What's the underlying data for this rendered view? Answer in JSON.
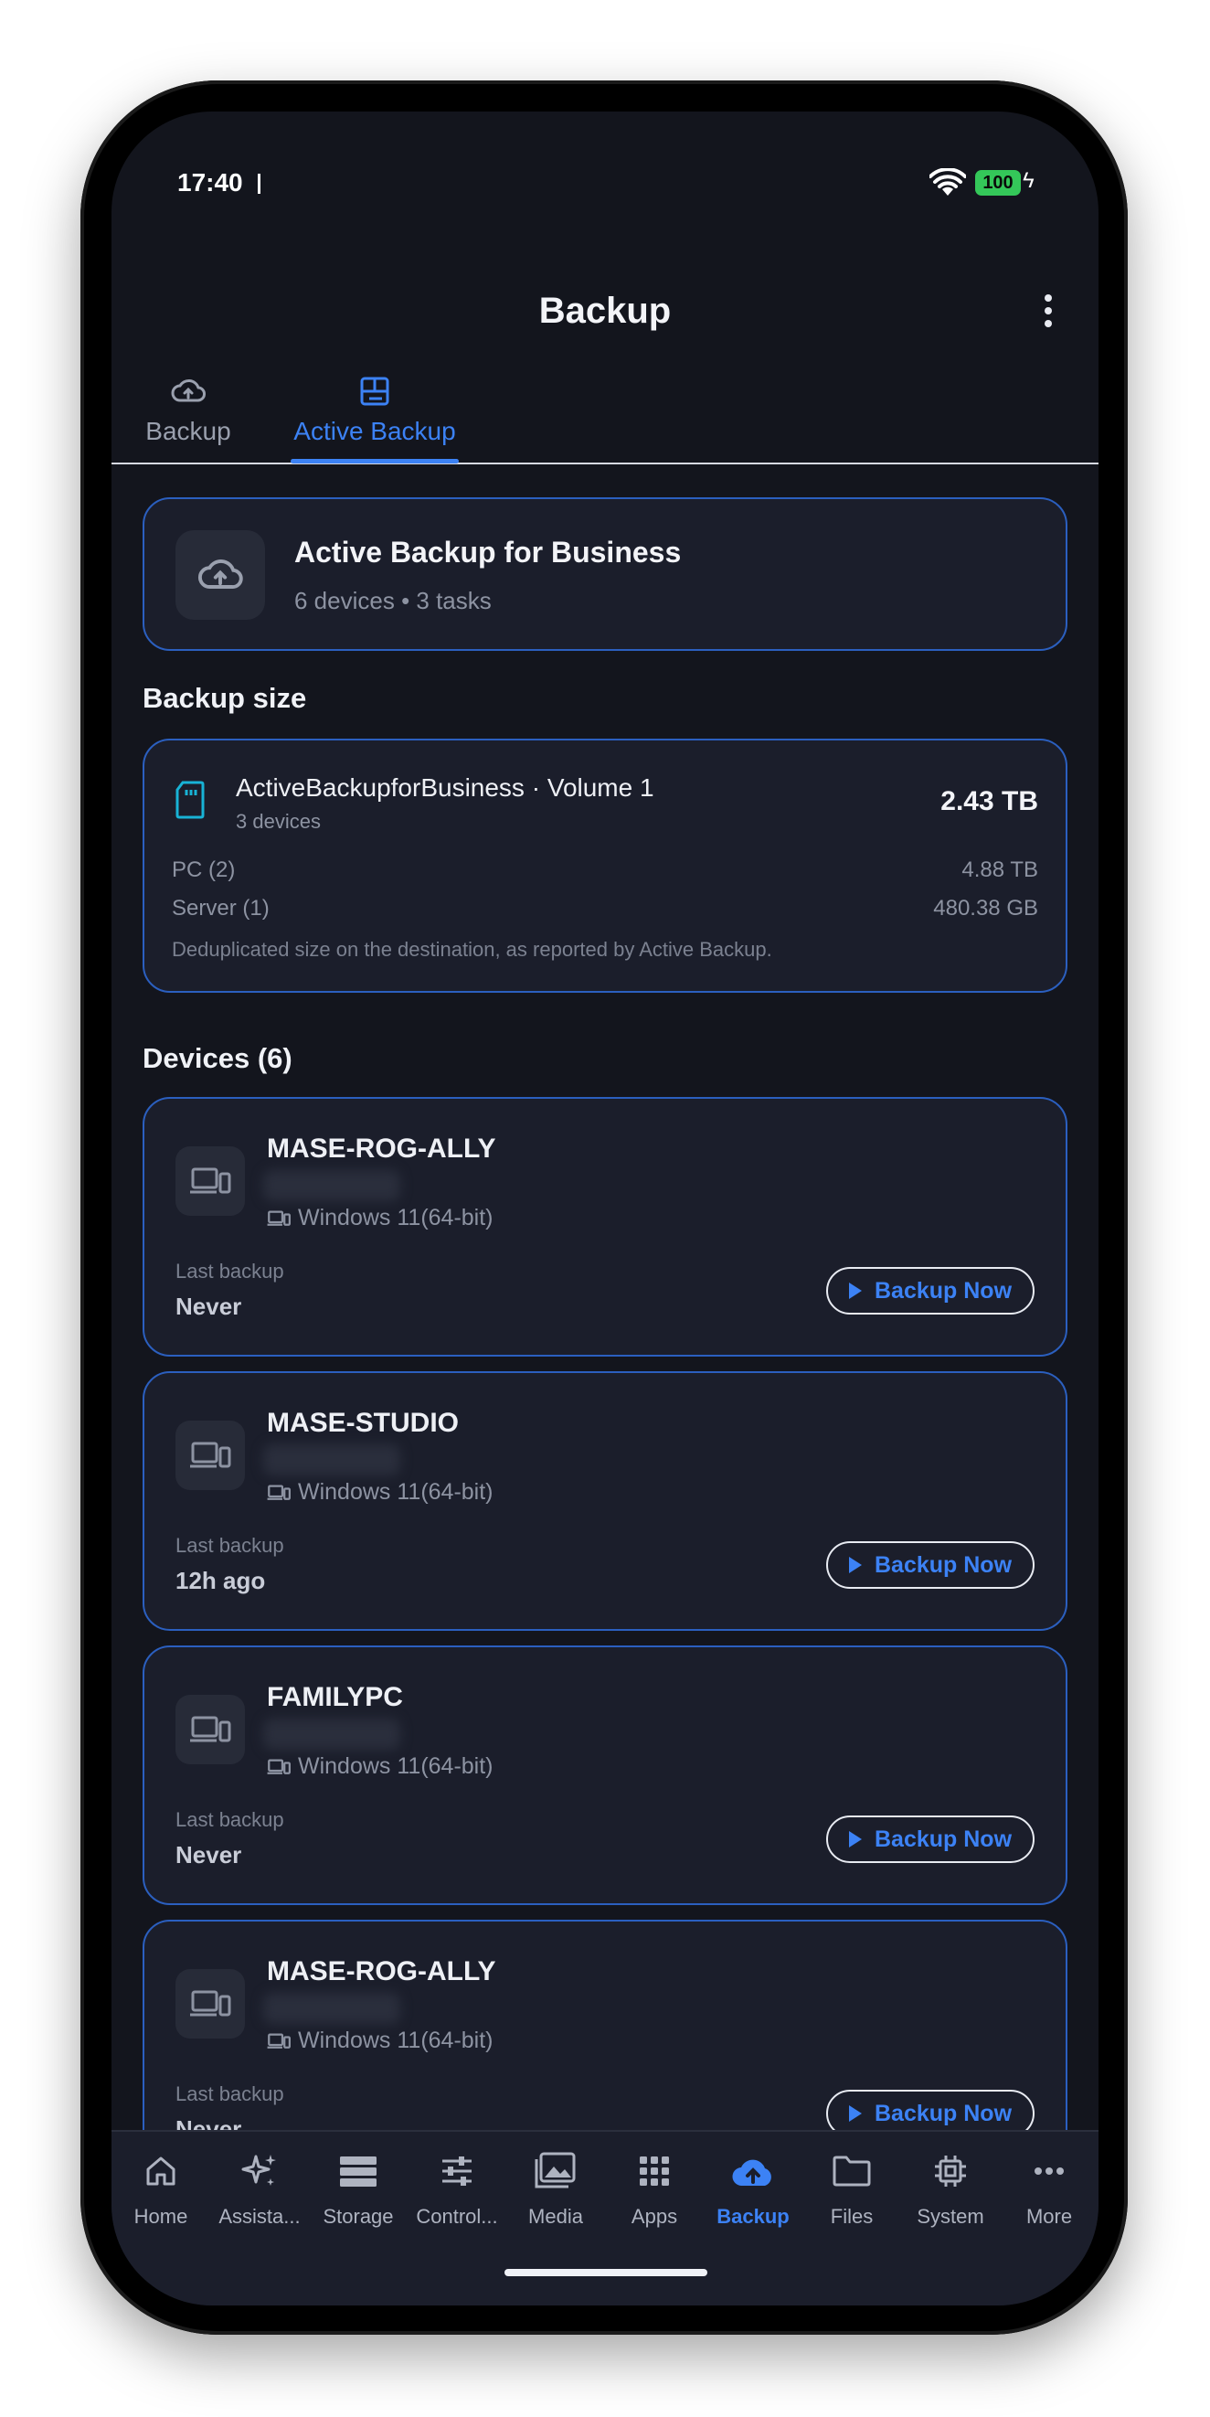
{
  "status_bar": {
    "time": "17:40",
    "battery": "100"
  },
  "header": {
    "title": "Backup"
  },
  "tabs": [
    {
      "label": "Backup",
      "icon": "cloud-upload-icon",
      "active": false
    },
    {
      "label": "Active Backup",
      "icon": "active-backup-icon",
      "active": true
    }
  ],
  "summary": {
    "title": "Active Backup for Business",
    "subtitle": "6 devices • 3 tasks",
    "icon": "cloud-upload-icon"
  },
  "backup_size": {
    "section_title": "Backup size",
    "volume_name": "ActiveBackupforBusiness · Volume 1",
    "volume_devices": "3 devices",
    "total": "2.43 TB",
    "rows": [
      {
        "label": "PC (2)",
        "value": "4.88 TB"
      },
      {
        "label": "Server (1)",
        "value": "480.38 GB"
      }
    ],
    "note": "Deduplicated size on the destination, as reported by Active Backup."
  },
  "devices": {
    "section_title": "Devices (6)",
    "items": [
      {
        "name": "MASE-ROG-ALLY",
        "os": "Windows 11(64-bit)",
        "last_label": "Last backup",
        "last_value": "Never",
        "button": "Backup Now"
      },
      {
        "name": "MASE-STUDIO",
        "os": "Windows 11(64-bit)",
        "last_label": "Last backup",
        "last_value": "12h ago",
        "button": "Backup Now"
      },
      {
        "name": "FAMILYPC",
        "os": "Windows 11(64-bit)",
        "last_label": "Last backup",
        "last_value": "Never",
        "button": "Backup Now"
      },
      {
        "name": "MASE-ROG-ALLY",
        "os": "Windows 11(64-bit)",
        "last_label": "Last backup",
        "last_value": "Never",
        "button": "Backup Now"
      }
    ]
  },
  "nav": [
    {
      "label": "Home",
      "icon": "home-icon"
    },
    {
      "label": "Assista...",
      "icon": "sparkle-icon"
    },
    {
      "label": "Storage",
      "icon": "storage-icon"
    },
    {
      "label": "Control...",
      "icon": "sliders-icon"
    },
    {
      "label": "Media",
      "icon": "media-icon"
    },
    {
      "label": "Apps",
      "icon": "apps-grid-icon"
    },
    {
      "label": "Backup",
      "icon": "cloud-upload-icon",
      "active": true
    },
    {
      "label": "Files",
      "icon": "folder-icon"
    },
    {
      "label": "System",
      "icon": "chip-icon"
    },
    {
      "label": "More",
      "icon": "more-dots-icon"
    }
  ],
  "colors": {
    "accent": "#3c82f5",
    "background": "#13151d",
    "card": "#1b1e2b",
    "card_border": "#2b5fbf"
  }
}
